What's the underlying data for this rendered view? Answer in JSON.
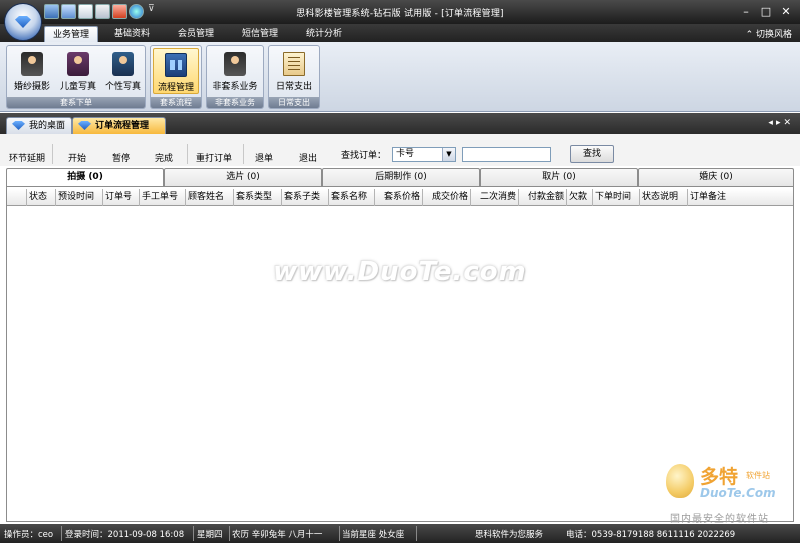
{
  "window": {
    "title": "思科影楼管理系统-钻石版 试用版 - [订单流程管理]",
    "controls": [
      "–",
      "□",
      "✕"
    ]
  },
  "ribbon_tabs": [
    "业务管理",
    "基础资料",
    "会员管理",
    "短信管理",
    "统计分析"
  ],
  "switch_skin": "切换风格",
  "ribbon_groups": [
    {
      "label": "套系下单",
      "buttons": [
        "婚纱摄影",
        "儿童写真",
        "个性写真"
      ]
    },
    {
      "label": "套系流程",
      "buttons": [
        "流程管理"
      ]
    },
    {
      "label": "非套系业务",
      "buttons": [
        "非套系业务"
      ]
    },
    {
      "label": "日常支出",
      "buttons": [
        "日常支出"
      ]
    }
  ],
  "doc_tabs": [
    "我的桌面",
    "订单流程管理"
  ],
  "toolbar": {
    "buttons": [
      "环节延期",
      "开始",
      "暂停",
      "完成",
      "重打订单",
      "退单",
      "退出"
    ],
    "search_label": "查找订单：",
    "search_select": "卡号",
    "search_value": "",
    "search_button": "查找"
  },
  "stage_tabs": [
    "拍摄 (0)",
    "选片 (0)",
    "后期制作 (0)",
    "取片 (0)",
    "婚庆 (0)"
  ],
  "grid_columns": [
    "状态",
    "预设时间",
    "订单号",
    "手工单号",
    "顾客姓名",
    "套系类型",
    "套系子类",
    "套系名称",
    "套系价格",
    "成交价格",
    "二次消费",
    "付款金额",
    "欠款",
    "下单时间",
    "状态说明",
    "订单备注"
  ],
  "watermark": "www.DuoTe.com",
  "corner_logo": {
    "big": "多特",
    "small": "软件站",
    "url": "DuoTe.Com",
    "slogan": "国内最安全的软件站"
  },
  "status": {
    "operator": "操作员：ceo",
    "login_time": "登录时间：2011-09-08 16:08",
    "weekday": "星期四",
    "lunar": "农历 辛卯兔年 八月十一",
    "constellation": "当前星座 处女座",
    "service": "思科软件为您服务",
    "phone": "电话：0539-8179188 8611116 2022269"
  }
}
